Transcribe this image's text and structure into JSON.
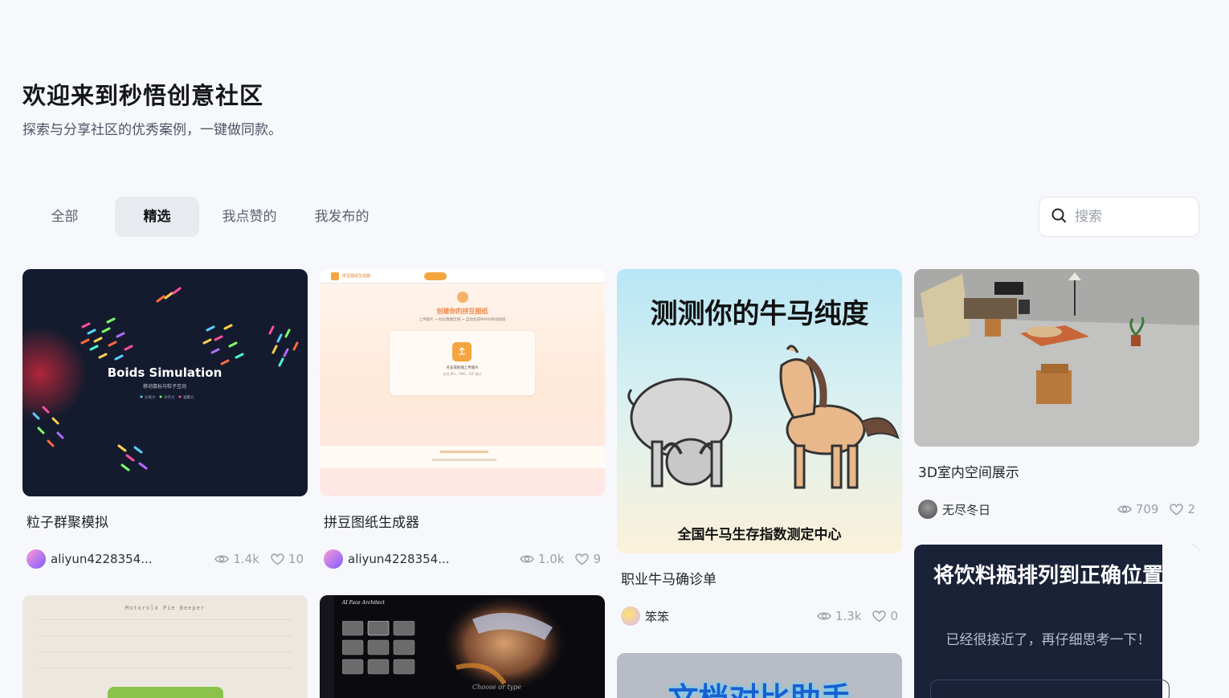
{
  "hero": {
    "title": "欢迎来到秒悟创意社区",
    "subtitle": "探索与分享社区的优秀案例，一键做同款。"
  },
  "tabs": [
    {
      "label": "全部",
      "active": false
    },
    {
      "label": "精选",
      "active": true
    },
    {
      "label": "我点赞的",
      "active": false
    },
    {
      "label": "我发布的",
      "active": false
    }
  ],
  "search": {
    "placeholder": "搜索",
    "value": ""
  },
  "cards": [
    {
      "title": "粒子群聚模拟",
      "author": "aliyun4228354...",
      "views": "1.4k",
      "likes": "10",
      "thumb_title": "Boids Simulation",
      "thumb_sub": "移动鼠标与粒子互动",
      "thumb_legend": [
        "分离力",
        "对齐力",
        "凝聚力"
      ]
    },
    {
      "title": "拼豆图纸生成器",
      "author": "aliyun4228354...",
      "views": "1.0k",
      "likes": "9",
      "thumb_title": "创建你的拼豆图纸",
      "thumb_sub": "上传图片 → 标记像素区域 → 自动生成MARD色号图纸",
      "thumb_upload": "点击或拖拽上传图片",
      "thumb_formats": "支持 JPG、PNG、GIF 格式",
      "thumb_app": "拼豆图纸生成器"
    },
    {
      "title": "职业牛马确诊单",
      "author": "笨笨",
      "views": "1.3k",
      "likes": "0",
      "thumb_title": "测测你的牛马纯度",
      "thumb_caption": "全国牛马生存指数测定中心"
    },
    {
      "title": "3D室内空间展示",
      "author": "无尽冬日",
      "views": "709",
      "likes": "2"
    },
    {
      "thumb_title": "Motorola Pie Beeper"
    },
    {
      "thumb_title": "AI Face Architect",
      "thumb_caption": "Choose or type"
    },
    {
      "thumb_title": "文档对比助手"
    },
    {
      "thumb_title": "将饮料瓶排列到正确位置",
      "thumb_sub": "已经很接近了，再仔细思考一下！"
    }
  ],
  "colors": {
    "accent_orange": "#f5a540",
    "tab_active_bg": "#e8eaf0",
    "page_bg": "#f7f8fb",
    "dark_navy": "#1a2238"
  }
}
